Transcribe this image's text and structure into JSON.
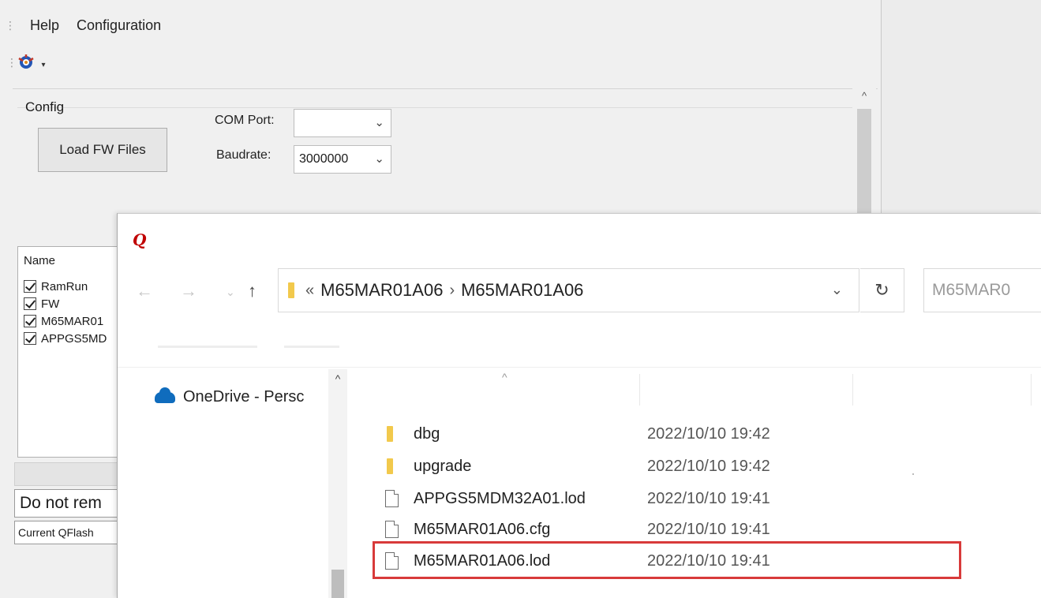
{
  "menubar": {
    "items": [
      "Help",
      "Configuration"
    ]
  },
  "toolbar": {
    "icons": [
      "app-gear-icon",
      "dropdown-arrow-icon"
    ]
  },
  "config": {
    "legend": "Config",
    "load_button": "Load FW Files",
    "com_port_label": "COM Port:",
    "com_port_value": "",
    "baudrate_label": "Baudrate:",
    "baudrate_value": "3000000"
  },
  "file_list": {
    "header": "Name",
    "items": [
      {
        "label": "RamRun",
        "checked": true
      },
      {
        "label": "FW",
        "checked": true
      },
      {
        "label": "M65MAR01",
        "checked": true
      },
      {
        "label": "APPGS5MD",
        "checked": true
      }
    ]
  },
  "status": {
    "warning": "Do not rem",
    "current": "Current QFlash"
  },
  "dialog": {
    "logo": "Q",
    "address": {
      "prefix": "«",
      "crumbs": [
        "M65MAR01A06",
        "M65MAR01A06"
      ]
    },
    "search_placeholder": "M65MAR0",
    "nav_pane": {
      "onedrive": "OneDrive - Persc"
    },
    "files": [
      {
        "name": "dbg",
        "date": "2022/10/10 19:42",
        "type": "folder"
      },
      {
        "name": "upgrade",
        "date": "2022/10/10 19:42",
        "type": "folder"
      },
      {
        "name": "APPGS5MDM32A01.lod",
        "date": "2022/10/10 19:41",
        "type": "file"
      },
      {
        "name": "M65MAR01A06.cfg",
        "date": "2022/10/10 19:41",
        "type": "file"
      },
      {
        "name": "M65MAR01A06.lod",
        "date": "2022/10/10 19:41",
        "type": "file"
      }
    ],
    "highlighted_file": "M65MAR01A06.lod"
  },
  "colors": {
    "highlight": "#d83a3a",
    "folder": "#f2c94c",
    "onedrive": "#0f6cbd",
    "logo": "#c00000"
  }
}
